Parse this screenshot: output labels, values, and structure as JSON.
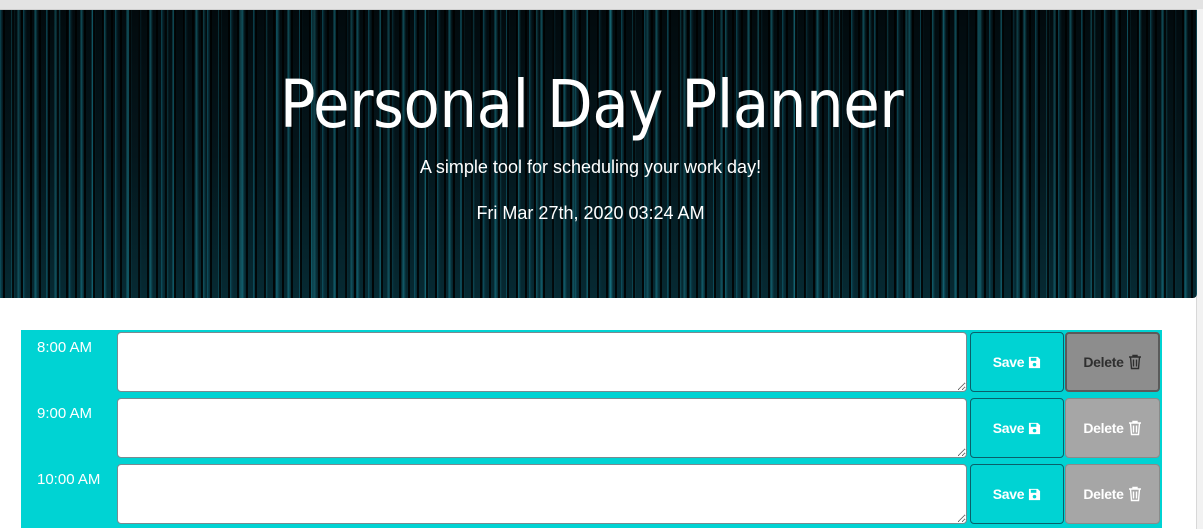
{
  "header": {
    "title": "Personal Day Planner",
    "subtitle": "A simple tool for scheduling your work day!",
    "current_datetime": "Fri Mar 27th, 2020 03:24 AM"
  },
  "theme": {
    "accent": "#00d3d3",
    "delete_gray": "#a6a6a6"
  },
  "rows": [
    {
      "time_label": "8:00 AM",
      "entry_value": "",
      "save_label": "Save",
      "delete_label": "Delete",
      "save_icon": "floppy-disk-icon",
      "delete_icon": "trash-icon"
    },
    {
      "time_label": "9:00 AM",
      "entry_value": "",
      "save_label": "Save",
      "delete_label": "Delete",
      "save_icon": "floppy-disk-icon",
      "delete_icon": "trash-icon"
    },
    {
      "time_label": "10:00 AM",
      "entry_value": "",
      "save_label": "Save",
      "delete_label": "Delete",
      "save_icon": "floppy-disk-icon",
      "delete_icon": "trash-icon"
    }
  ]
}
